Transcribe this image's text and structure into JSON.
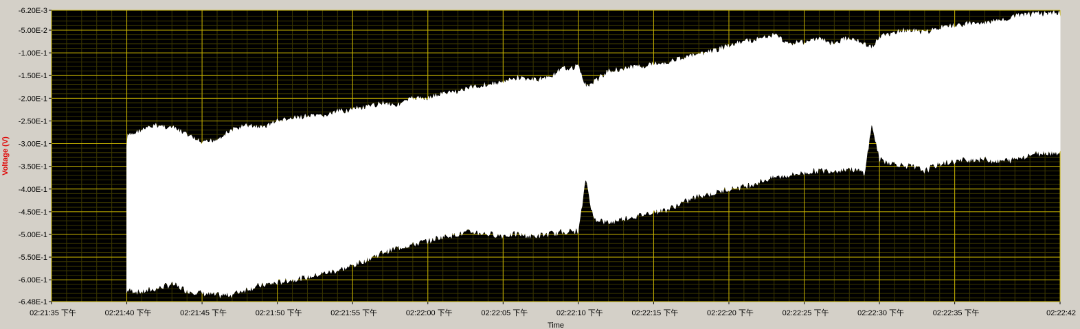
{
  "chart_data": {
    "type": "area",
    "xlabel": "Time",
    "ylabel": "Voltage (V)",
    "ylim": [
      -0.648,
      -0.0062
    ],
    "xlim_seconds_after_x_start": [
      0,
      67
    ],
    "x_start": "02:21:35 下午",
    "y_ticks": [
      {
        "value": -0.0062,
        "label": "-6.20E-3"
      },
      {
        "value": -0.05,
        "label": "-5.00E-2"
      },
      {
        "value": -0.1,
        "label": "-1.00E-1"
      },
      {
        "value": -0.15,
        "label": "-1.50E-1"
      },
      {
        "value": -0.2,
        "label": "-2.00E-1"
      },
      {
        "value": -0.25,
        "label": "-2.50E-1"
      },
      {
        "value": -0.3,
        "label": "-3.00E-1"
      },
      {
        "value": -0.35,
        "label": "-3.50E-1"
      },
      {
        "value": -0.4,
        "label": "-4.00E-1"
      },
      {
        "value": -0.45,
        "label": "-4.50E-1"
      },
      {
        "value": -0.5,
        "label": "-5.00E-1"
      },
      {
        "value": -0.55,
        "label": "-5.50E-1"
      },
      {
        "value": -0.6,
        "label": "-6.00E-1"
      },
      {
        "value": -0.648,
        "label": "-6.48E-1"
      }
    ],
    "x_ticks": [
      {
        "t": 0,
        "label": "02:21:35 下午"
      },
      {
        "t": 5,
        "label": "02:21:40 下午"
      },
      {
        "t": 10,
        "label": "02:21:45 下午"
      },
      {
        "t": 15,
        "label": "02:21:50 下午"
      },
      {
        "t": 20,
        "label": "02:21:55 下午"
      },
      {
        "t": 25,
        "label": "02:22:00 下午"
      },
      {
        "t": 30,
        "label": "02:22:05 下午"
      },
      {
        "t": 35,
        "label": "02:22:10 下午"
      },
      {
        "t": 40,
        "label": "02:22:15 下午"
      },
      {
        "t": 45,
        "label": "02:22:20 下午"
      },
      {
        "t": 50,
        "label": "02:22:25 下午"
      },
      {
        "t": 55,
        "label": "02:22:30 下午"
      },
      {
        "t": 60,
        "label": "02:22:35 下午"
      },
      {
        "t": 67,
        "label": "02:22:42"
      }
    ],
    "series": [
      {
        "color": "#ffffff",
        "t": [
          5,
          5,
          6,
          7,
          8,
          9,
          10,
          11,
          12,
          13,
          14,
          15,
          16,
          17,
          18,
          19,
          20,
          21,
          22,
          23,
          24,
          25,
          26,
          27,
          28,
          29,
          30,
          31,
          32,
          33,
          34,
          35,
          35.5,
          36,
          37,
          38,
          39,
          40,
          41,
          42,
          43,
          44,
          45,
          46,
          47,
          48,
          49,
          50,
          51,
          52,
          53,
          54,
          54.5,
          55,
          56,
          57,
          58,
          59,
          60,
          61,
          62,
          63,
          64,
          65,
          66,
          67
        ],
        "upper": [
          -0.3,
          -0.28,
          -0.265,
          -0.255,
          -0.26,
          -0.275,
          -0.295,
          -0.285,
          -0.265,
          -0.255,
          -0.26,
          -0.245,
          -0.24,
          -0.235,
          -0.235,
          -0.225,
          -0.22,
          -0.215,
          -0.205,
          -0.21,
          -0.195,
          -0.195,
          -0.185,
          -0.18,
          -0.17,
          -0.165,
          -0.16,
          -0.15,
          -0.155,
          -0.15,
          -0.13,
          -0.125,
          -0.17,
          -0.16,
          -0.135,
          -0.13,
          -0.125,
          -0.12,
          -0.115,
          -0.105,
          -0.1,
          -0.09,
          -0.08,
          -0.07,
          -0.065,
          -0.055,
          -0.075,
          -0.07,
          -0.065,
          -0.075,
          -0.06,
          -0.075,
          -0.085,
          -0.06,
          -0.05,
          -0.045,
          -0.05,
          -0.04,
          -0.035,
          -0.03,
          -0.03,
          -0.025,
          -0.015,
          -0.01,
          -0.008,
          -0.008
        ],
        "lower": [
          -0.628,
          -0.628,
          -0.632,
          -0.625,
          -0.615,
          -0.63,
          -0.635,
          -0.64,
          -0.638,
          -0.625,
          -0.618,
          -0.612,
          -0.605,
          -0.6,
          -0.592,
          -0.585,
          -0.575,
          -0.56,
          -0.545,
          -0.535,
          -0.528,
          -0.52,
          -0.51,
          -0.505,
          -0.5,
          -0.505,
          -0.508,
          -0.505,
          -0.51,
          -0.505,
          -0.5,
          -0.498,
          -0.38,
          -0.47,
          -0.48,
          -0.47,
          -0.465,
          -0.455,
          -0.45,
          -0.435,
          -0.42,
          -0.415,
          -0.405,
          -0.4,
          -0.39,
          -0.38,
          -0.375,
          -0.37,
          -0.365,
          -0.365,
          -0.36,
          -0.37,
          -0.26,
          -0.34,
          -0.35,
          -0.355,
          -0.365,
          -0.35,
          -0.345,
          -0.34,
          -0.34,
          -0.345,
          -0.34,
          -0.33,
          -0.325,
          -0.325
        ]
      }
    ],
    "grid": true,
    "background": "#000000",
    "grid_color": "#c8b400",
    "minor_grid_color": "#3a3600"
  }
}
